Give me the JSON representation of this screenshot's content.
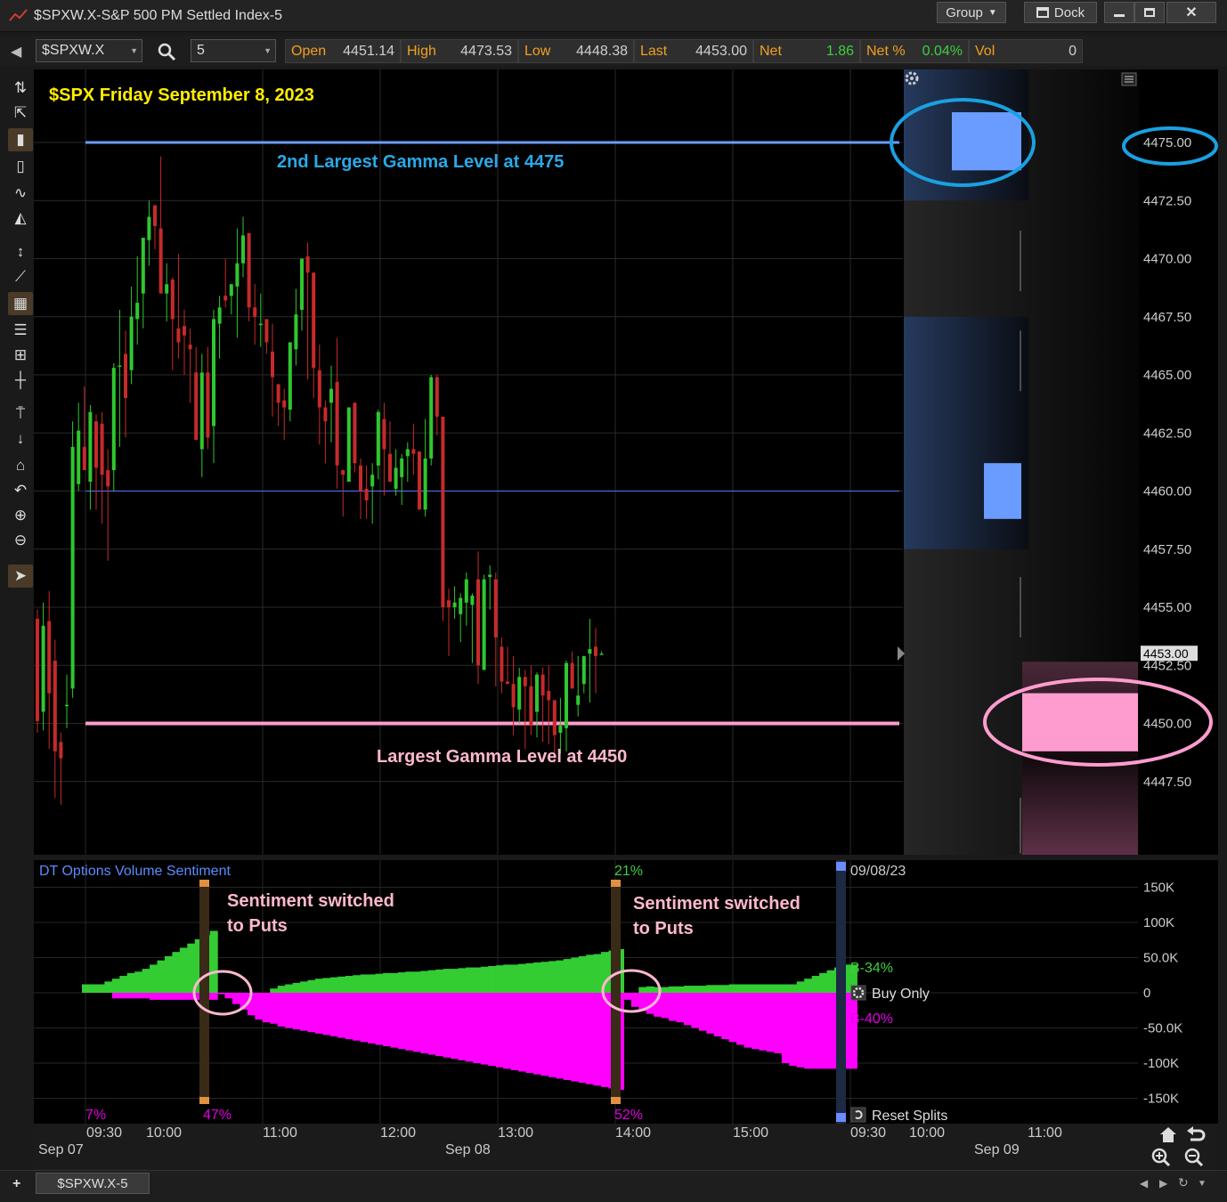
{
  "window": {
    "title": "$SPXW.X-S&P 500 PM Settled Index-5",
    "group_label": "Group",
    "dock_label": "Dock"
  },
  "quote": {
    "symbol": "$SPXW.X",
    "interval": "5",
    "fields": [
      {
        "label": "Open",
        "value": "4451.14",
        "color": "#cfcfcf"
      },
      {
        "label": "High",
        "value": "4473.53",
        "color": "#cfcfcf"
      },
      {
        "label": "Low",
        "value": "4448.38",
        "color": "#cfcfcf"
      },
      {
        "label": "Last",
        "value": "4453.00",
        "color": "#cfcfcf"
      },
      {
        "label": "Net",
        "value": "1.86",
        "color": "#3ecf3e"
      },
      {
        "label": "Net %",
        "value": "0.04%",
        "color": "#3ecf3e"
      },
      {
        "label": "Vol",
        "value": "0",
        "color": "#cfcfcf"
      }
    ]
  },
  "chart": {
    "title": "$SPX Friday September 8, 2023",
    "annotation_upper": "2nd Largest Gamma Level at 4475",
    "annotation_lower": "Largest Gamma Level at 4450",
    "last_price_tag": "4453.00",
    "price_ticks": [
      "4475.00",
      "4472.50",
      "4470.00",
      "4467.50",
      "4465.00",
      "4462.50",
      "4460.00",
      "4457.50",
      "4455.00",
      "4452.50",
      "4450.00",
      "4447.50"
    ],
    "colors": {
      "up": "#2fc72f",
      "down": "#c62a2a",
      "gamma_2nd": "#6a9cff",
      "gamma_1st": "#ff9ccf",
      "title": "#ffee00"
    }
  },
  "chart_data": {
    "type": "candlestick",
    "title": "$SPX Friday September 8, 2023",
    "interval_minutes": 5,
    "y_range": [
      4445.5,
      4478.5
    ],
    "horizontal_levels": [
      {
        "label": "2nd Largest Gamma Level at 4475",
        "value": 4475.0
      },
      {
        "label": "Largest Gamma Level at 4450",
        "value": 4450.0
      },
      {
        "value": 4460.0
      }
    ],
    "gamma_bars": [
      {
        "price": 4475.0,
        "size": 0.3
      },
      {
        "price": 4460.0,
        "size": 0.12
      },
      {
        "price": 4450.0,
        "size": 0.5
      }
    ],
    "candles": [
      [
        4454.5,
        4454.9,
        4449.6,
        4450.1
      ],
      [
        4450.5,
        4455.2,
        4449.7,
        4454.2
      ],
      [
        4454.4,
        4455.7,
        4448.9,
        4451.3
      ],
      [
        4452.7,
        4453.6,
        4446.8,
        4448.8
      ],
      [
        4449.2,
        4449.6,
        4446.5,
        4448.5
      ],
      [
        4450.8,
        4452.1,
        4449.8,
        4450.8
      ],
      [
        4451.5,
        4463.0,
        4451.1,
        4461.9
      ],
      [
        4460.3,
        4463.8,
        4460.0,
        4462.6
      ],
      [
        4461.9,
        4464.5,
        4461.2,
        4460.9
      ],
      [
        4460.4,
        4463.7,
        4459.2,
        4463.4
      ],
      [
        4463.0,
        4463.3,
        4459.2,
        4461.0
      ],
      [
        4462.9,
        4463.4,
        4458.6,
        4460.7
      ],
      [
        4460.9,
        4461.8,
        4457.0,
        4460.2
      ],
      [
        4460.9,
        4465.5,
        4460.0,
        4465.3
      ],
      [
        4465.4,
        4467.8,
        4461.9,
        4465.4
      ],
      [
        4465.9,
        4466.9,
        4462.3,
        4464.0
      ],
      [
        4465.2,
        4468.8,
        4464.6,
        4467.5
      ],
      [
        4467.4,
        4470.1,
        4466.3,
        4468.1
      ],
      [
        4468.5,
        4470.2,
        4467.0,
        4470.9
      ],
      [
        4470.8,
        4472.5,
        4469.7,
        4471.8
      ],
      [
        4472.3,
        4472.3,
        4470.4,
        4471.4
      ],
      [
        4471.3,
        4474.4,
        4469.2,
        4468.5
      ],
      [
        4468.5,
        4469.8,
        4467.3,
        4468.9
      ],
      [
        4469.1,
        4469.2,
        4465.2,
        4467.4
      ],
      [
        4467.0,
        4470.2,
        4465.7,
        4466.4
      ],
      [
        4467.1,
        4467.8,
        4465.0,
        4466.7
      ],
      [
        4466.3,
        4467.0,
        4463.8,
        4466.1
      ],
      [
        4465.1,
        4466.2,
        4463.0,
        4462.2
      ],
      [
        4461.8,
        4465.9,
        4460.6,
        4465.1
      ],
      [
        4465.1,
        4466.2,
        4461.8,
        4462.3
      ],
      [
        4462.8,
        4467.8,
        4461.2,
        4467.4
      ],
      [
        4467.2,
        4468.4,
        4465.7,
        4467.9
      ],
      [
        4468.4,
        4470.0,
        4467.9,
        4468.2
      ],
      [
        4468.4,
        4468.9,
        4467.6,
        4468.9
      ],
      [
        4468.8,
        4471.3,
        4466.6,
        4469.8
      ],
      [
        4469.8,
        4471.8,
        4469.2,
        4471.0
      ],
      [
        4471.1,
        4471.1,
        4467.3,
        4467.9
      ],
      [
        4467.9,
        4468.9,
        4466.3,
        4467.5
      ],
      [
        4467.2,
        4468.5,
        4466.2,
        4467.2
      ],
      [
        4467.4,
        4467.1,
        4465.9,
        4466.4
      ],
      [
        4466.0,
        4467.2,
        4463.2,
        4464.9
      ],
      [
        4464.6,
        4464.3,
        4462.8,
        4463.8
      ],
      [
        4463.9,
        4464.4,
        4462.2,
        4463.6
      ],
      [
        4463.5,
        4465.6,
        4463.0,
        4466.4
      ],
      [
        4466.1,
        4468.7,
        4465.4,
        4467.6
      ],
      [
        4467.8,
        4470.0,
        4466.9,
        4470.0
      ],
      [
        4470.1,
        4470.7,
        4464.8,
        4469.4
      ],
      [
        4469.4,
        4466.3,
        4464.0,
        4465.3
      ],
      [
        4465.2,
        4466.3,
        4462.0,
        4463.6
      ],
      [
        4463.6,
        4463.9,
        4461.2,
        4463.0
      ],
      [
        4463.8,
        4465.4,
        4462.1,
        4464.4
      ],
      [
        4464.7,
        4466.6,
        4460.1,
        4461.1
      ],
      [
        4460.9,
        4460.7,
        4458.9,
        4460.7
      ],
      [
        4460.4,
        4462.0,
        4460.7,
        4463.6
      ],
      [
        4463.8,
        4463.5,
        4460.8,
        4461.2
      ],
      [
        4461.1,
        4461.4,
        4458.8,
        4460.0
      ],
      [
        4460.1,
        4461.1,
        4458.8,
        4459.6
      ],
      [
        4460.2,
        4461.2,
        4458.6,
        4460.7
      ],
      [
        4461.1,
        4463.5,
        4460.5,
        4463.4
      ],
      [
        4463.1,
        4463.8,
        4459.8,
        4461.8
      ],
      [
        4461.6,
        4463.0,
        4460.4,
        4460.4
      ],
      [
        4460.1,
        4461.8,
        4459.8,
        4461.0
      ],
      [
        4460.6,
        4461.6,
        4459.4,
        4461.4
      ],
      [
        4461.5,
        4462.1,
        4460.4,
        4461.8
      ],
      [
        4461.8,
        4462.9,
        4460.7,
        4461.6
      ],
      [
        4461.7,
        4461.1,
        4459.2,
        4459.2
      ],
      [
        4459.2,
        4463.1,
        4458.9,
        4461.4
      ],
      [
        4461.4,
        4465.0,
        4461.1,
        4464.9
      ],
      [
        4464.9,
        4465.0,
        4462.4,
        4463.2
      ],
      [
        4463.2,
        4463.2,
        4454.4,
        4455.0
      ],
      [
        4455.3,
        4455.8,
        4452.9,
        4455.0
      ],
      [
        4455.0,
        4455.9,
        4454.5,
        4455.2
      ],
      [
        4454.7,
        4455.6,
        4453.5,
        4455.4
      ],
      [
        4455.2,
        4456.5,
        4454.2,
        4456.2
      ],
      [
        4455.1,
        4455.6,
        4452.6,
        4455.5
      ],
      [
        4456.2,
        4457.4,
        4451.7,
        4452.5
      ],
      [
        4452.3,
        4456.4,
        4452.3,
        4456.2
      ],
      [
        4456.3,
        4456.8,
        4454.9,
        4456.4
      ],
      [
        4456.2,
        4456.5,
        4451.6,
        4453.7
      ],
      [
        4453.3,
        4453.7,
        4451.3,
        4451.8
      ],
      [
        4451.8,
        4453.3,
        4451.9,
        4451.7
      ],
      [
        4451.7,
        4452.9,
        4449.5,
        4450.7
      ],
      [
        4450.6,
        4452.4,
        4450.0,
        4452.0
      ],
      [
        4452.0,
        4452.3,
        4448.9,
        4451.6
      ],
      [
        4451.6,
        4452.5,
        4449.5,
        4449.9
      ],
      [
        4450.5,
        4452.2,
        4449.4,
        4452.1
      ],
      [
        4452.1,
        4452.4,
        4449.2,
        4451.2
      ],
      [
        4451.4,
        4452.5,
        4449.1,
        4451.0
      ],
      [
        4451.0,
        4450.7,
        4448.3,
        4449.5
      ],
      [
        4449.6,
        4451.1,
        4448.7,
        4449.9
      ],
      [
        4449.8,
        4452.7,
        4448.8,
        4452.6
      ],
      [
        4452.6,
        4453.1,
        4451.7,
        4451.5
      ],
      [
        4450.8,
        4452.9,
        4450.3,
        4451.2
      ],
      [
        4451.7,
        4452.9,
        4451.3,
        4452.9
      ],
      [
        4453.0,
        4454.5,
        4450.9,
        4453.2
      ],
      [
        4453.3,
        4454.1,
        4451.3,
        4452.9
      ],
      [
        4453.0,
        4453.1,
        4453.0,
        4453.0
      ]
    ]
  },
  "sentiment": {
    "title": "DT Options Volume Sentiment",
    "annotation1": [
      "Sentiment switched",
      "to Puts"
    ],
    "annotation2": [
      "Sentiment switched",
      "to Puts"
    ],
    "pct_labels": [
      {
        "text": "7%",
        "color": "#e000e0"
      },
      {
        "text": "47%",
        "color": "#e000e0"
      },
      {
        "text": "21%",
        "color": "#3ecf3e"
      },
      {
        "text": "52%",
        "color": "#e000e0"
      }
    ],
    "date_label": "09/08/23",
    "call_label": "B-34%",
    "put_label": "B-40%",
    "buy_only_label": "Buy Only",
    "reset_label": "Reset Splits",
    "ticks": [
      "150K",
      "100K",
      "50.0K",
      "0",
      "-50.0K",
      "-100K",
      "-150K"
    ],
    "call_values": [
      12,
      12,
      12,
      16,
      20,
      24,
      28,
      30,
      34,
      40,
      46,
      52,
      58,
      64,
      70,
      76,
      82,
      88,
      -2,
      -5,
      -6,
      -8,
      -10,
      -12,
      -14,
      6,
      10,
      12,
      14,
      16,
      18,
      20,
      21,
      22,
      23,
      24,
      25,
      26,
      26,
      27,
      28,
      28,
      29,
      30,
      30,
      31,
      32,
      33,
      34,
      34,
      35,
      36,
      36,
      37,
      38,
      39,
      40,
      40,
      41,
      42,
      43,
      44,
      45,
      46,
      48,
      50,
      52,
      54,
      55,
      58,
      60,
      62,
      -4,
      -8,
      8,
      9,
      8,
      8,
      9,
      9,
      10,
      10,
      10,
      11,
      11,
      11,
      12,
      12,
      12,
      12,
      12,
      12,
      12,
      12,
      12,
      16,
      20,
      24,
      28,
      32,
      36,
      40,
      40
    ],
    "put_values": [
      0,
      0,
      0,
      0,
      -8,
      -8,
      -8,
      -8,
      -8,
      -10,
      -10,
      -10,
      -10,
      -10,
      -10,
      -10,
      -10,
      -10,
      -2,
      -8,
      -16,
      -24,
      -32,
      -38,
      -42,
      -44,
      -48,
      -50,
      -52,
      -54,
      -56,
      -58,
      -60,
      -62,
      -64,
      -66,
      -68,
      -70,
      -72,
      -74,
      -76,
      -78,
      -80,
      -82,
      -84,
      -86,
      -88,
      -90,
      -92,
      -94,
      -96,
      -98,
      -100,
      -102,
      -104,
      -106,
      -108,
      -110,
      -112,
      -114,
      -116,
      -118,
      -120,
      -122,
      -124,
      -126,
      -128,
      -130,
      -132,
      -134,
      -136,
      -138,
      -10,
      -20,
      -26,
      -30,
      -34,
      -36,
      -40,
      -42,
      -46,
      -50,
      -54,
      -58,
      -62,
      -66,
      -70,
      -74,
      -78,
      -80,
      -82,
      -84,
      -86,
      -100,
      -104,
      -106,
      -108,
      -108,
      -108,
      -108,
      -108,
      -108,
      -108
    ],
    "colors": {
      "calls": "#33cc33",
      "puts": "#ff00ff",
      "text": "#ffb8d0"
    }
  },
  "time_axis": {
    "time_labels": [
      "09:30",
      "10:00",
      "11:00",
      "12:00",
      "13:00",
      "14:00",
      "15:00",
      "09:30",
      "10:00",
      "11:00"
    ],
    "date_labels": [
      "Sep 07",
      "Sep 08",
      "Sep 09"
    ]
  },
  "footer": {
    "tab_label": "$SPXW.X-5"
  }
}
